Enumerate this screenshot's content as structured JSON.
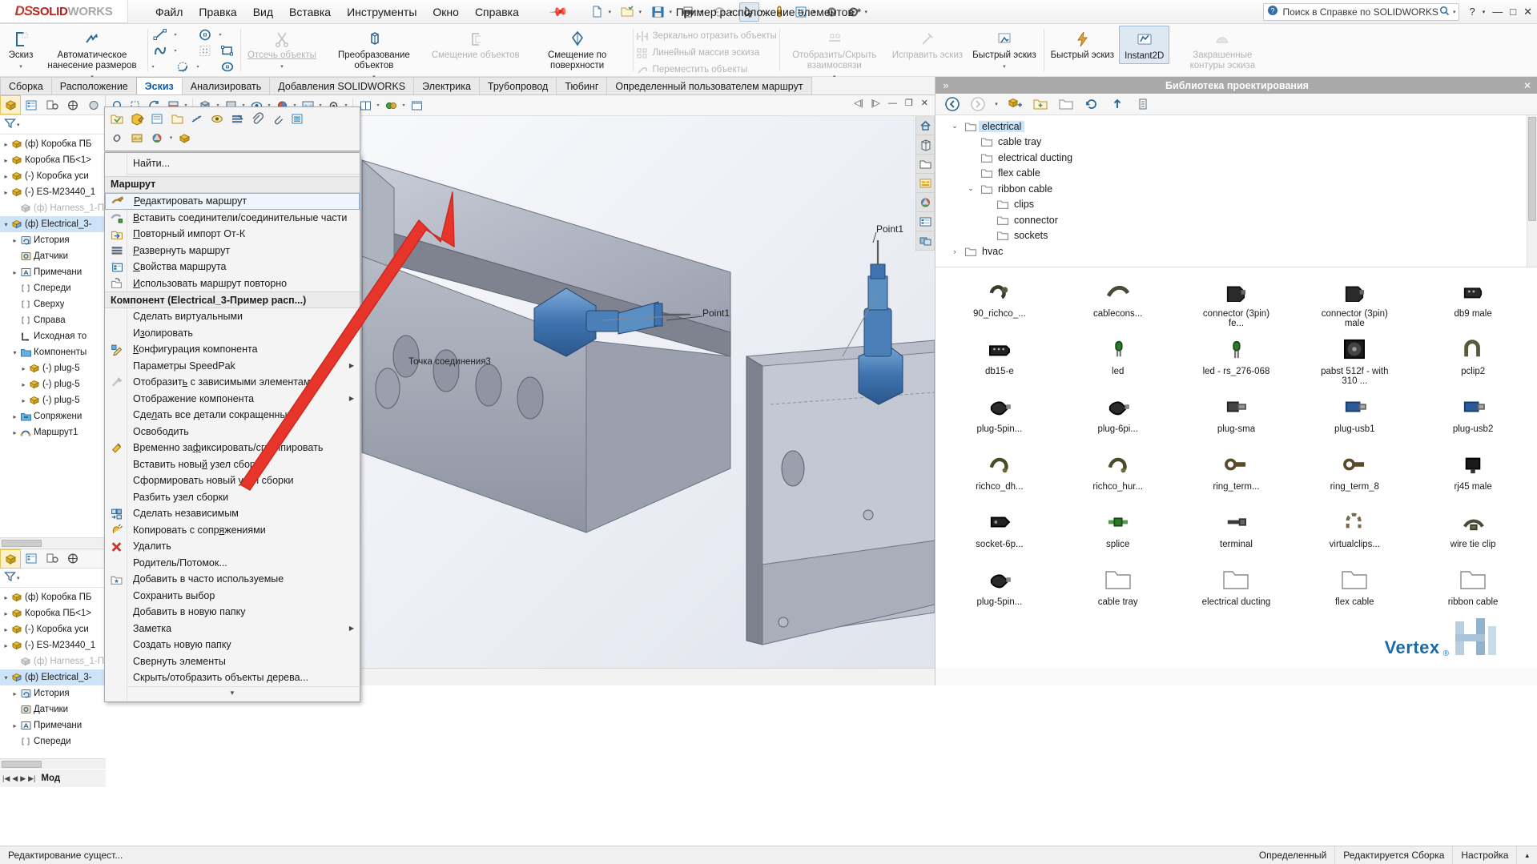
{
  "titlebar": {
    "logo_ds": "DS",
    "logo_solid": "SOLID",
    "logo_works": "WORKS",
    "menus": [
      "Файл",
      "Правка",
      "Вид",
      "Вставка",
      "Инструменты",
      "Окно",
      "Справка"
    ],
    "document_title": "Пример расположение элементов *",
    "search_placeholder": "Поиск в Справке по SOLIDWORKS",
    "help_label": "?",
    "window_controls": [
      "—",
      "□",
      "✕"
    ]
  },
  "ribbon": {
    "groups": [
      {
        "items": [
          {
            "label": "Эскиз",
            "icon": "sketch-icon",
            "dropdown": true,
            "disabled": false
          },
          {
            "label": "Автоматическое нанесение размеров",
            "icon": "smart-dimension-icon",
            "dropdown": true,
            "disabled": false
          }
        ]
      },
      {
        "items": [
          {
            "label": "Отсечь объекты",
            "icon": "trim-entities-icon",
            "dropdown": true,
            "disabled": true
          },
          {
            "label": "Преобразование объектов",
            "icon": "convert-entities-icon",
            "dropdown": true,
            "disabled": false
          },
          {
            "label": "Смещение объектов",
            "icon": "offset-entities-icon",
            "dropdown": false,
            "disabled": true
          },
          {
            "label": "Смещение по поверхности",
            "icon": "offset-on-surface-icon",
            "dropdown": false,
            "disabled": false
          }
        ]
      },
      {
        "text_items": [
          {
            "label": "Зеркально отразить объекты",
            "icon": "mirror-entities-icon",
            "disabled": true
          },
          {
            "label": "Линейный массив эскиза",
            "icon": "linear-sketch-pattern-icon",
            "disabled": true
          },
          {
            "label": "Переместить объекты",
            "icon": "move-entities-icon",
            "disabled": true
          }
        ]
      },
      {
        "items": [
          {
            "label": "Отобразить/Скрыть взаимосвязи",
            "icon": "display-delete-relations-icon",
            "dropdown": true,
            "disabled": true
          },
          {
            "label": "Исправить эскиз",
            "icon": "repair-sketch-icon",
            "dropdown": false,
            "disabled": true
          },
          {
            "label": "Быстрый эскиз",
            "icon": "quick-snaps-icon",
            "dropdown": true,
            "disabled": false
          }
        ]
      },
      {
        "items": [
          {
            "label": "Быстрый эскиз",
            "icon": "rapid-sketch-icon",
            "dropdown": false,
            "disabled": false
          },
          {
            "label": "Instant2D",
            "icon": "instant2d-icon",
            "dropdown": false,
            "disabled": false,
            "active": true
          },
          {
            "label": "Закрашенные контуры эскиза",
            "icon": "shaded-sketch-contours-icon",
            "dropdown": false,
            "disabled": true
          }
        ]
      }
    ]
  },
  "tabs": [
    {
      "label": "Сборка",
      "active": false
    },
    {
      "label": "Расположение",
      "active": false
    },
    {
      "label": "Эскиз",
      "active": true
    },
    {
      "label": "Анализировать",
      "active": false
    },
    {
      "label": "Добавления SOLIDWORKS",
      "active": false
    },
    {
      "label": "Электрика",
      "active": false
    },
    {
      "label": "Трубопровод",
      "active": false
    },
    {
      "label": "Тюбинг",
      "active": false
    },
    {
      "label": "Определенный пользователем маршрут",
      "active": false
    }
  ],
  "feature_tree_top": [
    {
      "label": "(ф) Коробка ПБ",
      "icon": "component-icon",
      "indent": 0,
      "expand": "collapsed",
      "dim": false,
      "selected": false
    },
    {
      "label": "Коробка ПБ<1>",
      "icon": "component-icon",
      "indent": 0,
      "expand": "collapsed",
      "dim": false,
      "selected": false
    },
    {
      "label": "(-) Коробка уси",
      "icon": "component-icon",
      "indent": 0,
      "expand": "collapsed",
      "dim": false,
      "selected": false
    },
    {
      "label": "(-) ES-M23440_1",
      "icon": "component-icon",
      "indent": 0,
      "expand": "collapsed",
      "dim": false,
      "selected": false
    },
    {
      "label": "(ф) Harness_1-П",
      "icon": "harness-icon",
      "indent": 1,
      "expand": "none",
      "dim": true,
      "selected": false
    },
    {
      "label": "(ф) Electrical_3-",
      "icon": "route-assembly-icon",
      "indent": 0,
      "expand": "expanded",
      "dim": false,
      "selected": true
    },
    {
      "label": "История",
      "icon": "history-icon",
      "indent": 1,
      "expand": "collapsed",
      "dim": false,
      "selected": false
    },
    {
      "label": "Датчики",
      "icon": "sensors-icon",
      "indent": 1,
      "expand": "none",
      "dim": false,
      "selected": false
    },
    {
      "label": "Примечани",
      "icon": "annotations-icon",
      "indent": 1,
      "expand": "collapsed",
      "dim": false,
      "selected": false
    },
    {
      "label": "Спереди",
      "icon": "plane-icon",
      "indent": 1,
      "expand": "none",
      "dim": false,
      "selected": false
    },
    {
      "label": "Сверху",
      "icon": "plane-icon",
      "indent": 1,
      "expand": "none",
      "dim": false,
      "selected": false
    },
    {
      "label": "Справа",
      "icon": "plane-icon",
      "indent": 1,
      "expand": "none",
      "dim": false,
      "selected": false
    },
    {
      "label": "Исходная то",
      "icon": "origin-icon",
      "indent": 1,
      "expand": "none",
      "dim": false,
      "selected": false
    },
    {
      "label": "Компоненты",
      "icon": "folder-icon",
      "indent": 1,
      "expand": "expanded",
      "dim": false,
      "selected": false
    },
    {
      "label": "(-) plug-5",
      "icon": "component-icon",
      "indent": 2,
      "expand": "collapsed",
      "dim": false,
      "selected": false
    },
    {
      "label": "(-) plug-5",
      "icon": "component-icon",
      "indent": 2,
      "expand": "collapsed",
      "dim": false,
      "selected": false
    },
    {
      "label": "(-) plug-5",
      "icon": "component-icon",
      "indent": 2,
      "expand": "collapsed",
      "dim": false,
      "selected": false
    },
    {
      "label": "Сопряжени",
      "icon": "mates-folder-icon",
      "indent": 1,
      "expand": "collapsed",
      "dim": false,
      "selected": false
    },
    {
      "label": "Маршрут1",
      "icon": "route-icon",
      "indent": 1,
      "expand": "collapsed",
      "dim": false,
      "selected": false
    }
  ],
  "feature_tree_bottom": [
    {
      "label": "(ф) Коробка ПБ",
      "icon": "component-icon",
      "indent": 0,
      "expand": "collapsed",
      "dim": false,
      "selected": false
    },
    {
      "label": "Коробка ПБ<1>",
      "icon": "component-icon",
      "indent": 0,
      "expand": "collapsed",
      "dim": false,
      "selected": false
    },
    {
      "label": "(-) Коробка уси",
      "icon": "component-icon",
      "indent": 0,
      "expand": "collapsed",
      "dim": false,
      "selected": false
    },
    {
      "label": "(-) ES-M23440_1",
      "icon": "component-icon",
      "indent": 0,
      "expand": "collapsed",
      "dim": false,
      "selected": false
    },
    {
      "label": "(ф) Harness_1-П",
      "icon": "harness-icon",
      "indent": 1,
      "expand": "none",
      "dim": true,
      "selected": false
    },
    {
      "label": "(ф) Electrical_3-",
      "icon": "route-assembly-icon",
      "indent": 0,
      "expand": "expanded",
      "dim": false,
      "selected": true
    },
    {
      "label": "История",
      "icon": "history-icon",
      "indent": 1,
      "expand": "collapsed",
      "dim": false,
      "selected": false
    },
    {
      "label": "Датчики",
      "icon": "sensors-icon",
      "indent": 1,
      "expand": "none",
      "dim": false,
      "selected": false
    },
    {
      "label": "Примечани",
      "icon": "annotations-icon",
      "indent": 1,
      "expand": "collapsed",
      "dim": false,
      "selected": false
    },
    {
      "label": "Спереди",
      "icon": "plane-icon",
      "indent": 1,
      "expand": "none",
      "dim": false,
      "selected": false
    }
  ],
  "tree_footer": {
    "label": "Мод"
  },
  "context_menu": {
    "find_label": "Найти...",
    "section_route": "Маршрут",
    "route_items": [
      {
        "label": "Редактировать маршрут",
        "icon": "edit-route-icon",
        "underline": "Р",
        "highlighted": true
      },
      {
        "label": "Вставить соединители/соединительные части",
        "icon": "insert-connectors-icon",
        "underline": "В",
        "highlighted": false
      },
      {
        "label": "Повторный импорт От-К",
        "icon": "reimport-from-to-icon",
        "underline": "П",
        "highlighted": false
      },
      {
        "label": "Развернуть маршрут",
        "icon": "flatten-route-icon",
        "underline": "Р",
        "highlighted": false
      },
      {
        "label": "Свойства маршрута",
        "icon": "route-properties-icon",
        "underline": "С",
        "highlighted": false
      },
      {
        "label": "Использовать маршрут повторно",
        "icon": "reuse-route-icon",
        "underline": "И",
        "highlighted": false
      }
    ],
    "section_component": "Компонент (Electrical_3-Пример расп...)",
    "component_items": [
      {
        "label": "Сделать виртуальными",
        "icon": "",
        "underline": "д",
        "submenu": false
      },
      {
        "label": "Изолировать",
        "icon": "",
        "underline": "з",
        "submenu": false
      },
      {
        "label": "Конфигурация компонента",
        "icon": "configure-component-icon",
        "underline": "К",
        "submenu": false
      },
      {
        "label": "Параметры SpeedPak",
        "icon": "",
        "underline": "",
        "submenu": true
      },
      {
        "label": "Отобразить с зависимыми элементами",
        "icon": "show-with-dependents-icon",
        "underline": "ь",
        "submenu": false
      },
      {
        "label": "Отображение компонента",
        "icon": "",
        "underline": "",
        "submenu": true
      },
      {
        "label": "Сделать все детали сокращенными",
        "icon": "",
        "underline": "л",
        "submenu": false
      },
      {
        "label": "Освободить",
        "icon": "",
        "underline": "",
        "submenu": false
      },
      {
        "label": "Временно зафиксировать/сгруппировать",
        "icon": "temporary-fix-group-icon",
        "underline": "ф",
        "submenu": false
      },
      {
        "label": "Вставить новый узел сборки",
        "icon": "",
        "underline": "й",
        "submenu": false
      },
      {
        "label": "Сформировать новый узел сборки",
        "icon": "",
        "underline": "",
        "submenu": false
      },
      {
        "label": "Разбить узел сборки",
        "icon": "",
        "underline": "",
        "submenu": false
      },
      {
        "label": "Сделать независимым",
        "icon": "make-independent-icon",
        "underline": "",
        "submenu": false
      },
      {
        "label": "Копировать с сопряжениями",
        "icon": "copy-with-mates-icon",
        "underline": "я",
        "submenu": false
      },
      {
        "label": "Удалить",
        "icon": "delete-icon",
        "underline": "",
        "submenu": false
      },
      {
        "label": "Родитель/Потомок...",
        "icon": "",
        "underline": "",
        "submenu": false
      },
      {
        "label": "Добавить в часто используемые",
        "icon": "add-to-favorites-icon",
        "underline": "",
        "submenu": false
      },
      {
        "label": "Сохранить выбор",
        "icon": "",
        "underline": "",
        "submenu": false
      },
      {
        "label": "Добавить в новую папку",
        "icon": "",
        "underline": "",
        "submenu": false
      },
      {
        "label": "Заметка",
        "icon": "",
        "underline": "",
        "submenu": true
      },
      {
        "label": "Создать новую папку",
        "icon": "",
        "underline": "",
        "submenu": false
      },
      {
        "label": "Свернуть элементы",
        "icon": "",
        "underline": "",
        "submenu": false
      },
      {
        "label": "Скрыть/отобразить объекты дерева...",
        "icon": "",
        "underline": "",
        "submenu": false
      }
    ],
    "scroll_more": "▼"
  },
  "viewport": {
    "callouts": [
      "Point1",
      "Point1",
      "Точка соединения3"
    ],
    "window_controls": [
      "◀",
      "▶",
      "—",
      "❐",
      "✕"
    ]
  },
  "design_library": {
    "title": "Библиотека проектирования",
    "tree": [
      {
        "label": "electrical",
        "indent": 0,
        "expand": "expanded",
        "selected": true
      },
      {
        "label": "cable tray",
        "indent": 1,
        "expand": "none",
        "selected": false
      },
      {
        "label": "electrical ducting",
        "indent": 1,
        "expand": "none",
        "selected": false
      },
      {
        "label": "flex cable",
        "indent": 1,
        "expand": "none",
        "selected": false
      },
      {
        "label": "ribbon cable",
        "indent": 1,
        "expand": "expanded",
        "selected": false
      },
      {
        "label": "clips",
        "indent": 2,
        "expand": "none",
        "selected": false
      },
      {
        "label": "connector",
        "indent": 2,
        "expand": "none",
        "selected": false
      },
      {
        "label": "sockets",
        "indent": 2,
        "expand": "none",
        "selected": false
      },
      {
        "label": "hvac",
        "indent": 0,
        "expand": "collapsed",
        "selected": false
      }
    ],
    "grid": [
      {
        "label": "90_richco_...",
        "icon": "part-clip-icon"
      },
      {
        "label": "cablecons...",
        "icon": "part-cable-icon"
      },
      {
        "label": "connector (3pin) fe...",
        "icon": "part-connector-icon"
      },
      {
        "label": "connector (3pin) male",
        "icon": "part-connector-icon"
      },
      {
        "label": "db9 male",
        "icon": "part-db9-icon"
      },
      {
        "label": "db15-e",
        "icon": "part-db15-icon"
      },
      {
        "label": "led",
        "icon": "part-led-icon"
      },
      {
        "label": "led - rs_276-068",
        "icon": "part-led2-icon"
      },
      {
        "label": "pabst 512f - with 310 ...",
        "icon": "part-fan-icon"
      },
      {
        "label": "pclip2",
        "icon": "part-pclip-icon"
      },
      {
        "label": "plug-5pin...",
        "icon": "part-plug-icon"
      },
      {
        "label": "plug-6pi...",
        "icon": "part-plug-icon"
      },
      {
        "label": "plug-sma",
        "icon": "part-sma-icon"
      },
      {
        "label": "plug-usb1",
        "icon": "part-usb-icon"
      },
      {
        "label": "plug-usb2",
        "icon": "part-usb-icon"
      },
      {
        "label": "richco_dh...",
        "icon": "part-richco-icon"
      },
      {
        "label": "richco_hur...",
        "icon": "part-richco-icon"
      },
      {
        "label": "ring_term...",
        "icon": "part-ring-icon"
      },
      {
        "label": "ring_term_8",
        "icon": "part-ring-icon"
      },
      {
        "label": "rj45 male",
        "icon": "part-rj45-icon"
      },
      {
        "label": "socket-6p...",
        "icon": "part-socket-icon"
      },
      {
        "label": "splice",
        "icon": "part-splice-icon"
      },
      {
        "label": "terminal",
        "icon": "part-terminal-icon"
      },
      {
        "label": "virtualclips...",
        "icon": "part-virtualclip-icon"
      },
      {
        "label": "wire tie clip",
        "icon": "part-wiretie-icon"
      },
      {
        "label": "plug-5pin...",
        "icon": "part-plug-icon"
      },
      {
        "label": "cable tray",
        "icon": "folder-icon"
      },
      {
        "label": "electrical ducting",
        "icon": "folder-icon"
      },
      {
        "label": "flex cable",
        "icon": "folder-icon"
      },
      {
        "label": "ribbon cable",
        "icon": "folder-icon"
      }
    ],
    "watermark": {
      "text": "Vertex",
      "reg": "®"
    }
  },
  "statusbar": {
    "left": "Редактирование сущест...",
    "state": "Определенный",
    "editing": "Редактируется Сборка",
    "settings": "Настройка",
    "caret": "▴"
  }
}
